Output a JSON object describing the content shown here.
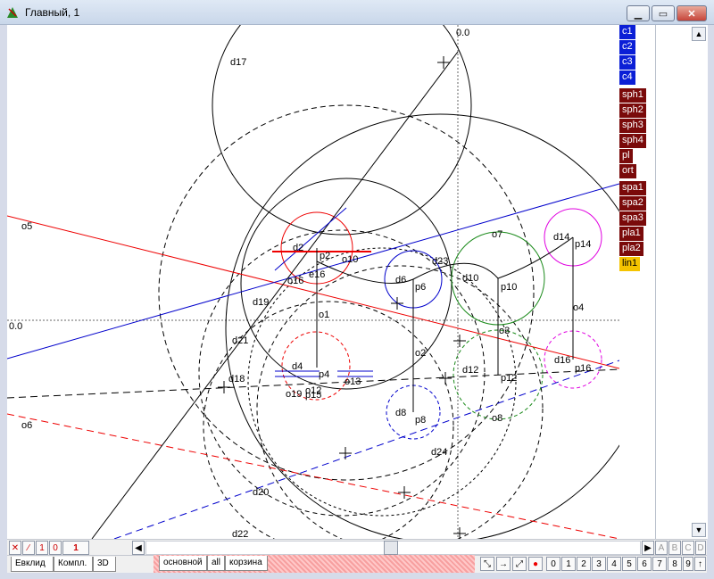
{
  "window": {
    "title": "Главный, 1",
    "min_label": "▁",
    "max_label": "▭",
    "close_label": "✕"
  },
  "axes": {
    "x_zero": "0.0",
    "y_zero": "0.0"
  },
  "canvas_labels": {
    "d17": "d17",
    "d2": "d2",
    "p2": "p2",
    "o10": "o10",
    "e16": "e16",
    "o16": "o16",
    "d23": "d23",
    "o7": "o7",
    "d10": "d10",
    "d6": "d6",
    "p6": "p6",
    "p10": "p10",
    "d14": "d14",
    "p14": "p14",
    "o4": "o4",
    "o5": "o5",
    "d19": "d19",
    "o1": "o1",
    "d21": "d21",
    "o3": "o3",
    "o2": "o2",
    "d4": "d4",
    "p4": "p4",
    "o13": "o13",
    "d18": "d18",
    "o12": "o12",
    "p15": "p15",
    "o19": "o19",
    "d12": "d12",
    "p12": "p12",
    "d16": "d16",
    "p16": "p16",
    "d8": "d8",
    "p8": "p8",
    "o8": "o8",
    "o6": "o6",
    "d24": "d24",
    "d20": "d20",
    "d22": "d22"
  },
  "objects": [
    {
      "name": "c1",
      "color": "#0b1fd6"
    },
    {
      "name": "c2",
      "color": "#0b1fd6"
    },
    {
      "name": "c3",
      "color": "#0b1fd6"
    },
    {
      "name": "c4",
      "color": "#0b1fd6"
    },
    {
      "name": "sph1",
      "color": "#7a0a0a"
    },
    {
      "name": "sph2",
      "color": "#7a0a0a"
    },
    {
      "name": "sph3",
      "color": "#7a0a0a"
    },
    {
      "name": "sph4",
      "color": "#7a0a0a"
    },
    {
      "name": "pl",
      "color": "#7a0a0a"
    },
    {
      "name": "ort",
      "color": "#7a0a0a"
    },
    {
      "name": "spa1",
      "color": "#7a0a0a"
    },
    {
      "name": "spa2",
      "color": "#7a0a0a"
    },
    {
      "name": "spa3",
      "color": "#7a0a0a"
    },
    {
      "name": "pla1",
      "color": "#7a0a0a"
    },
    {
      "name": "pla2",
      "color": "#7a0a0a"
    },
    {
      "name": "lin1",
      "color": "#f5c400"
    }
  ],
  "statusbar": {
    "btn_x": "✕",
    "btn_slash": "∕",
    "btn_1": "1",
    "btn_0": "0",
    "value": "1",
    "letters": [
      "A",
      "B",
      "C",
      "D"
    ]
  },
  "tabs": {
    "left": [
      "Евклид",
      "Компл.",
      "3D"
    ],
    "middle": [
      "основной",
      "all",
      "корзина"
    ]
  },
  "tools": {
    "numbers": [
      "0",
      "1",
      "2",
      "3",
      "4",
      "5",
      "6",
      "7",
      "8",
      "9"
    ],
    "up_arrow": "↑"
  }
}
